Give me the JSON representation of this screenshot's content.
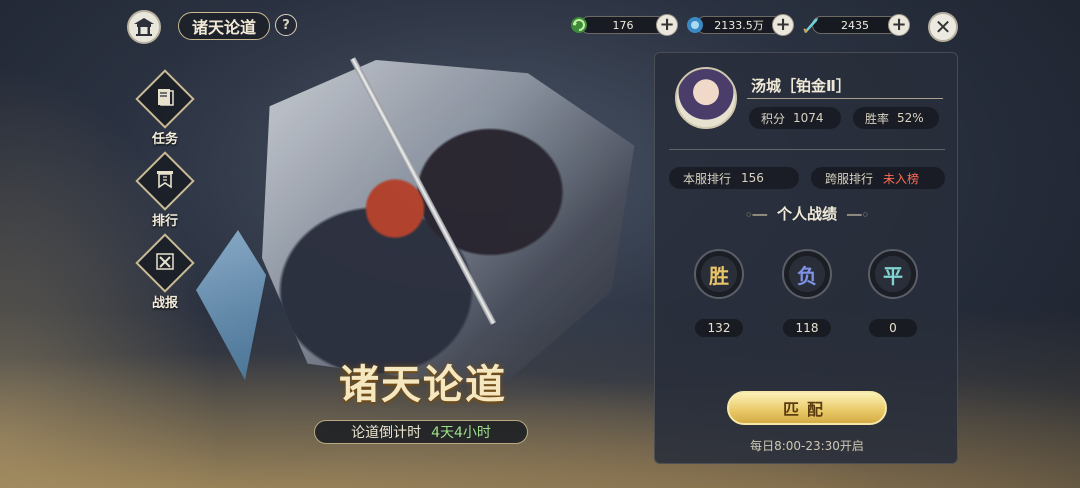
{
  "header": {
    "title": "诸天论道",
    "help": "?",
    "close": "✕",
    "resources": [
      {
        "icon": "green-refresh-icon",
        "value": "176"
      },
      {
        "icon": "blue-jade-icon",
        "value": "2133.5万"
      },
      {
        "icon": "crystal-sword-icon",
        "value": "2435"
      }
    ],
    "plus": "+"
  },
  "nav": [
    {
      "label": "任务",
      "icon": "scroll-book-icon"
    },
    {
      "label": "排行",
      "icon": "banner-icon"
    },
    {
      "label": "战报",
      "icon": "crossed-swords-icon"
    }
  ],
  "event": {
    "title": "诸天论道",
    "countdown_label": "论道倒计时",
    "countdown_value": "4天4小时"
  },
  "player": {
    "name": "汤城［铂金Ⅱ］",
    "score_label": "积分",
    "score": "1074",
    "winrate_label": "胜率",
    "winrate": "52%",
    "server_rank_label": "本服排行",
    "server_rank": "156",
    "cross_rank_label": "跨服排行",
    "cross_rank": "未入榜"
  },
  "record": {
    "title": "个人战绩",
    "items": [
      {
        "label": "胜",
        "count": "132",
        "color": "#e9c56a"
      },
      {
        "label": "负",
        "count": "118",
        "color": "#7e93e6"
      },
      {
        "label": "平",
        "count": "0",
        "color": "#7fd3d1"
      }
    ]
  },
  "match": {
    "button": "匹配",
    "schedule": "每日8:00-23:30开启"
  }
}
